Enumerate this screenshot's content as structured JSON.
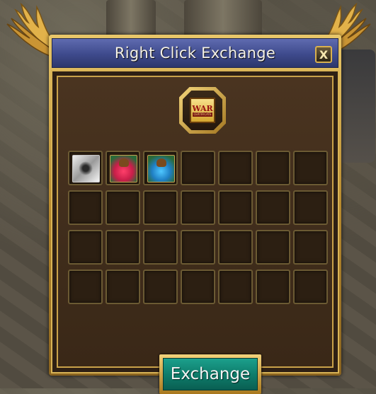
{
  "window": {
    "title": "Right Click Exchange",
    "close_label": "X"
  },
  "top_slot": {
    "item_icon": "war-certificate-icon",
    "item_text_main": "WAR",
    "item_text_sub": "CERTIFICATE"
  },
  "grid": {
    "rows": 4,
    "columns": 7,
    "slots": [
      {
        "icon": "scroll-item-icon"
      },
      {
        "icon": "red-potion-icon"
      },
      {
        "icon": "blue-potion-icon"
      },
      {},
      {},
      {},
      {},
      {},
      {},
      {},
      {},
      {},
      {},
      {},
      {},
      {},
      {},
      {},
      {},
      {},
      {},
      {},
      {},
      {},
      {},
      {},
      {},
      {}
    ]
  },
  "exchange_button": {
    "label": "Exchange"
  },
  "colors": {
    "title_bar": "#3e4a8c",
    "frame_gold": "#d9b456",
    "panel_brown": "#3f2c1b",
    "button_teal": "#0d7a69"
  }
}
